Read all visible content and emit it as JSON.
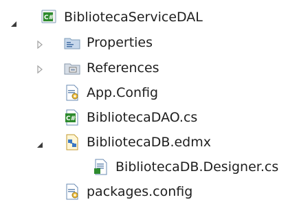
{
  "tree": {
    "root": {
      "label": "BibliotecaServiceDAL",
      "icon": "csharp-project-icon",
      "expanded": true
    },
    "items": [
      {
        "label": "Properties",
        "icon": "properties-folder-icon",
        "expanded": false
      },
      {
        "label": "References",
        "icon": "references-folder-icon",
        "expanded": false
      },
      {
        "label": "App.Config",
        "icon": "config-file-icon"
      },
      {
        "label": "BibliotecaDAO.cs",
        "icon": "csharp-file-icon"
      },
      {
        "label": "BibliotecaDB.edmx",
        "icon": "edmx-file-icon",
        "expanded": true
      },
      {
        "label": "BibliotecaDB.Designer.cs",
        "icon": "designer-file-icon"
      },
      {
        "label": "packages.config",
        "icon": "config-file-icon"
      }
    ]
  },
  "colors": {
    "text": "#1e1e1e",
    "expander": "#3c3c3c",
    "collapsed_expander": "#a6a6a6",
    "csharp_green": "#2e8b2e",
    "folder": "#9cb6d4"
  }
}
